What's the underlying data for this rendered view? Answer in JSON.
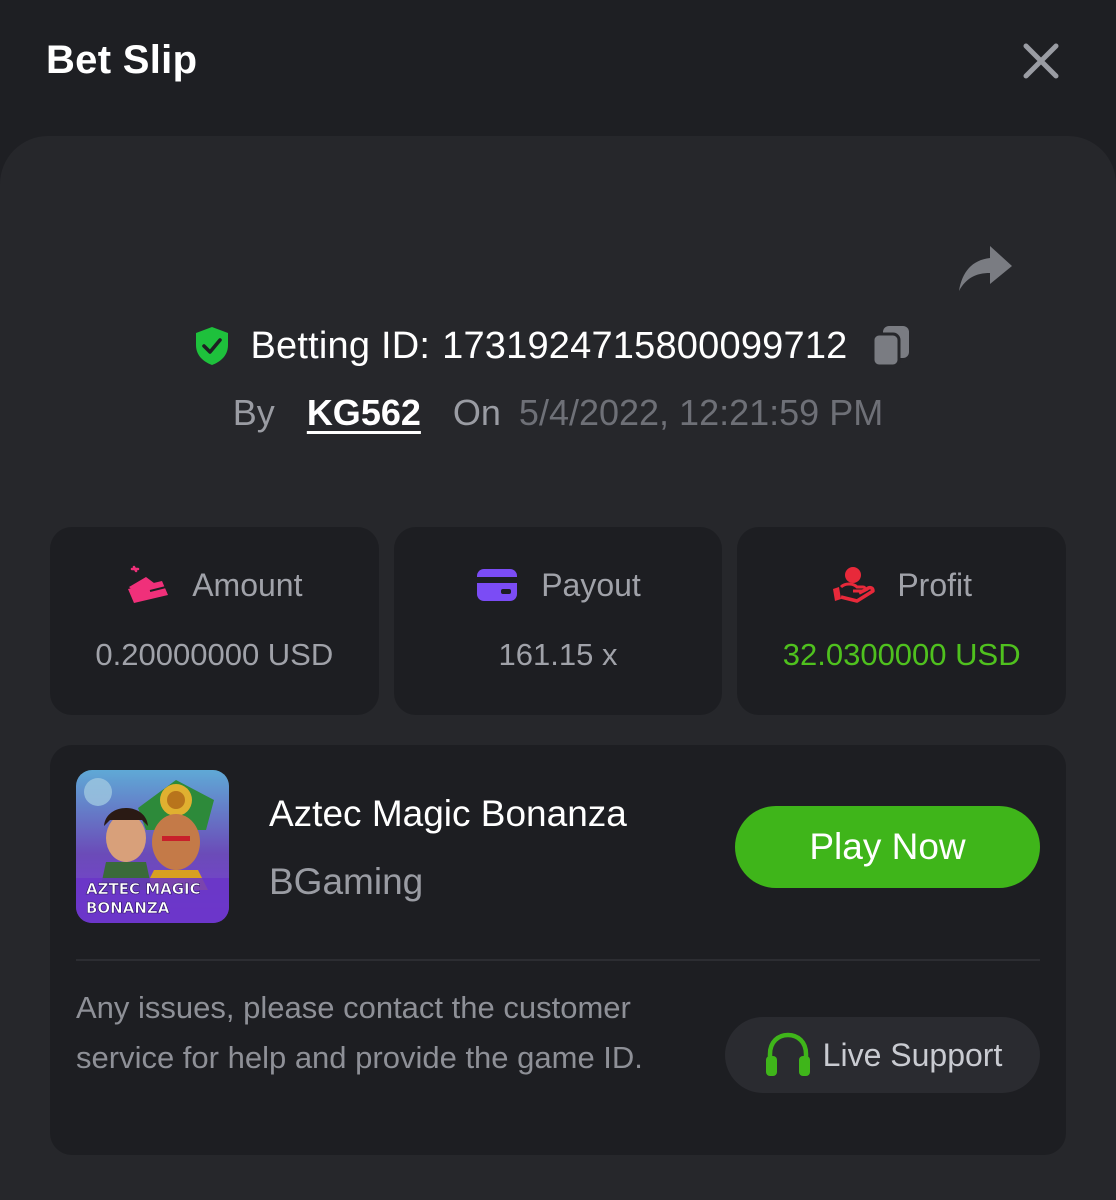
{
  "header": {
    "title": "Bet Slip"
  },
  "bet": {
    "id_label": "Betting ID:",
    "id_value": "1731924715800099712",
    "by_label": "By",
    "user": "KG562",
    "on_label": "On",
    "datetime": "5/4/2022, 12:21:59 PM"
  },
  "stats": [
    {
      "label": "Amount",
      "value": "0.20000000 USD",
      "icon": "wallet-money-icon"
    },
    {
      "label": "Payout",
      "value": "161.15 x",
      "icon": "card-icon"
    },
    {
      "label": "Profit",
      "value": "32.0300000 USD",
      "icon": "hand-coin-icon"
    }
  ],
  "game": {
    "name": "Aztec Magic Bonanza",
    "provider": "BGaming",
    "thumb_logo": "AZTEC MAGIC BONANZA",
    "play_label": "Play Now"
  },
  "support": {
    "note": "Any issues, please contact the customer service for help and provide the game ID.",
    "button_label": "Live Support"
  },
  "colors": {
    "background": "#1e1f23",
    "panel": "#26272b",
    "card": "#1d1e22",
    "accent_green": "#3fb51a",
    "profit_green": "#4fc11e",
    "shield_green": "#1ec13c",
    "amount_pink": "#f0307a",
    "payout_purple": "#7b4cf5",
    "profit_red": "#e8293a"
  }
}
